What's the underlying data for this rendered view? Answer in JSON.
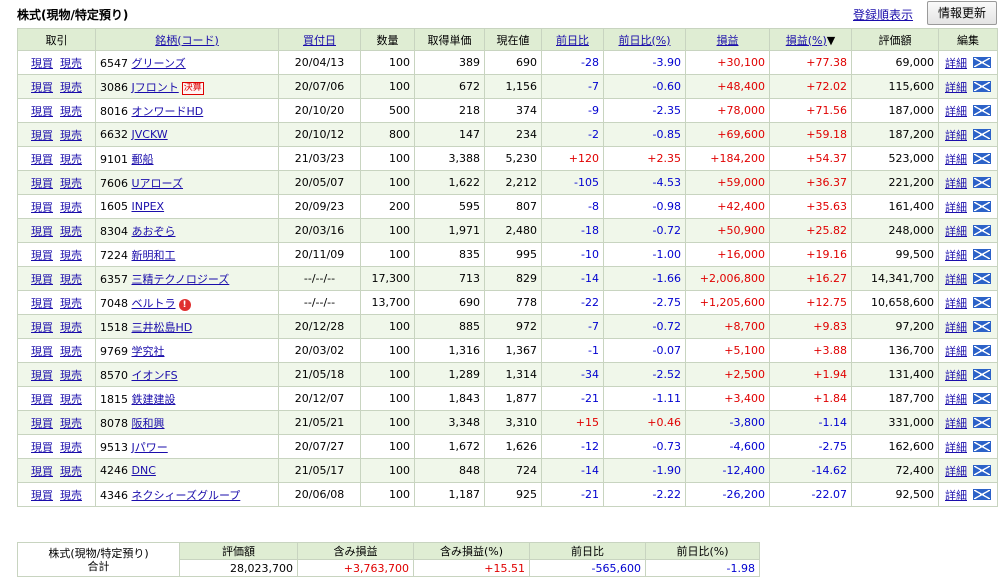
{
  "header": {
    "title": "株式(現物/特定預り)",
    "sort_link": "登録順表示",
    "refresh_button": "情報更新"
  },
  "columns": {
    "trade": "取引",
    "name": "銘柄(コード)",
    "buy_date": "買付日",
    "qty": "数量",
    "cost": "取得単価",
    "price": "現在値",
    "change": "前日比",
    "change_pct": "前日比(%)",
    "pl": "損益",
    "pl_pct": "損益(%)",
    "sort_marker": "▼",
    "value": "評価額",
    "edit": "編集"
  },
  "labels": {
    "buy": "現買",
    "sell": "現売",
    "detail": "詳細"
  },
  "rows": [
    {
      "code": "6547",
      "name": "グリーンズ",
      "date": "20/04/13",
      "qty": "100",
      "cost": "389",
      "price": "690",
      "chg": "-28",
      "chgp": "-3.90",
      "pl": "+30,100",
      "plp": "+77.38",
      "value": "69,000"
    },
    {
      "code": "3086",
      "name": "Jフロント",
      "badge": "決算",
      "date": "20/07/06",
      "qty": "100",
      "cost": "672",
      "price": "1,156",
      "chg": "-7",
      "chgp": "-0.60",
      "pl": "+48,400",
      "plp": "+72.02",
      "value": "115,600"
    },
    {
      "code": "8016",
      "name": "オンワードHD",
      "date": "20/10/20",
      "qty": "500",
      "cost": "218",
      "price": "374",
      "chg": "-9",
      "chgp": "-2.35",
      "pl": "+78,000",
      "plp": "+71.56",
      "value": "187,000"
    },
    {
      "code": "6632",
      "name": "JVCKW",
      "date": "20/10/12",
      "qty": "800",
      "cost": "147",
      "price": "234",
      "chg": "-2",
      "chgp": "-0.85",
      "pl": "+69,600",
      "plp": "+59.18",
      "value": "187,200"
    },
    {
      "code": "9101",
      "name": "郵船",
      "date": "21/03/23",
      "qty": "100",
      "cost": "3,388",
      "price": "5,230",
      "chg": "+120",
      "chgp": "+2.35",
      "pl": "+184,200",
      "plp": "+54.37",
      "value": "523,000"
    },
    {
      "code": "7606",
      "name": "Uアローズ",
      "date": "20/05/07",
      "qty": "100",
      "cost": "1,622",
      "price": "2,212",
      "chg": "-105",
      "chgp": "-4.53",
      "pl": "+59,000",
      "plp": "+36.37",
      "value": "221,200"
    },
    {
      "code": "1605",
      "name": "INPEX",
      "date": "20/09/23",
      "qty": "200",
      "cost": "595",
      "price": "807",
      "chg": "-8",
      "chgp": "-0.98",
      "pl": "+42,400",
      "plp": "+35.63",
      "value": "161,400"
    },
    {
      "code": "8304",
      "name": "あおぞら",
      "date": "20/03/16",
      "qty": "100",
      "cost": "1,971",
      "price": "2,480",
      "chg": "-18",
      "chgp": "-0.72",
      "pl": "+50,900",
      "plp": "+25.82",
      "value": "248,000"
    },
    {
      "code": "7224",
      "name": "新明和工",
      "date": "20/11/09",
      "qty": "100",
      "cost": "835",
      "price": "995",
      "chg": "-10",
      "chgp": "-1.00",
      "pl": "+16,000",
      "plp": "+19.16",
      "value": "99,500"
    },
    {
      "code": "6357",
      "name": "三精テクノロジーズ",
      "date": "--/--/--",
      "qty": "17,300",
      "cost": "713",
      "price": "829",
      "chg": "-14",
      "chgp": "-1.66",
      "pl": "+2,006,800",
      "plp": "+16.27",
      "value": "14,341,700"
    },
    {
      "code": "7048",
      "name": "ベルトラ",
      "alert": "!",
      "date": "--/--/--",
      "qty": "13,700",
      "cost": "690",
      "price": "778",
      "chg": "-22",
      "chgp": "-2.75",
      "pl": "+1,205,600",
      "plp": "+12.75",
      "value": "10,658,600"
    },
    {
      "code": "1518",
      "name": "三井松島HD",
      "date": "20/12/28",
      "qty": "100",
      "cost": "885",
      "price": "972",
      "chg": "-7",
      "chgp": "-0.72",
      "pl": "+8,700",
      "plp": "+9.83",
      "value": "97,200"
    },
    {
      "code": "9769",
      "name": "学究社",
      "date": "20/03/02",
      "qty": "100",
      "cost": "1,316",
      "price": "1,367",
      "chg": "-1",
      "chgp": "-0.07",
      "pl": "+5,100",
      "plp": "+3.88",
      "value": "136,700"
    },
    {
      "code": "8570",
      "name": "イオンFS",
      "date": "21/05/18",
      "qty": "100",
      "cost": "1,289",
      "price": "1,314",
      "chg": "-34",
      "chgp": "-2.52",
      "pl": "+2,500",
      "plp": "+1.94",
      "value": "131,400"
    },
    {
      "code": "1815",
      "name": "鉄建建設",
      "date": "20/12/07",
      "qty": "100",
      "cost": "1,843",
      "price": "1,877",
      "chg": "-21",
      "chgp": "-1.11",
      "pl": "+3,400",
      "plp": "+1.84",
      "value": "187,700"
    },
    {
      "code": "8078",
      "name": "阪和興",
      "date": "21/05/21",
      "qty": "100",
      "cost": "3,348",
      "price": "3,310",
      "chg": "+15",
      "chgp": "+0.46",
      "pl": "-3,800",
      "plp": "-1.14",
      "value": "331,000"
    },
    {
      "code": "9513",
      "name": "Jパワー",
      "date": "20/07/27",
      "qty": "100",
      "cost": "1,672",
      "price": "1,626",
      "chg": "-12",
      "chgp": "-0.73",
      "pl": "-4,600",
      "plp": "-2.75",
      "value": "162,600"
    },
    {
      "code": "4246",
      "name": "DNC",
      "date": "21/05/17",
      "qty": "100",
      "cost": "848",
      "price": "724",
      "chg": "-14",
      "chgp": "-1.90",
      "pl": "-12,400",
      "plp": "-14.62",
      "value": "72,400"
    },
    {
      "code": "4346",
      "name": "ネクシィーズグループ",
      "date": "20/06/08",
      "qty": "100",
      "cost": "1,187",
      "price": "925",
      "chg": "-21",
      "chgp": "-2.22",
      "pl": "-26,200",
      "plp": "-22.07",
      "value": "92,500"
    }
  ],
  "summary": {
    "label_top": "株式(現物/特定預り)",
    "label_bottom": "合計",
    "headers": [
      "評価額",
      "含み損益",
      "含み損益(%)",
      "前日比",
      "前日比(%)"
    ],
    "values": [
      "28,023,700",
      "+3,763,700",
      "+15.51",
      "-565,600",
      "-1.98"
    ]
  },
  "colors": {
    "header_bg": "#dfedd3",
    "row_alt": "#f0f7ea",
    "positive": "#e00000",
    "negative": "#0000d0",
    "link": "#1a0dab"
  }
}
